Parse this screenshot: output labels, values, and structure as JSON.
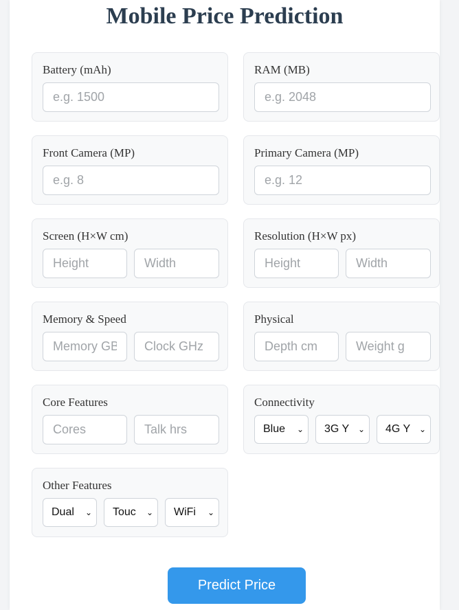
{
  "page": {
    "title": "Mobile Price Prediction"
  },
  "groups": {
    "battery": {
      "label": "Battery (mAh)",
      "placeholder": "e.g. 1500"
    },
    "ram": {
      "label": "RAM (MB)",
      "placeholder": "e.g. 2048"
    },
    "front_camera": {
      "label": "Front Camera (MP)",
      "placeholder": "e.g. 8"
    },
    "primary_camera": {
      "label": "Primary Camera (MP)",
      "placeholder": "e.g. 12"
    },
    "screen": {
      "label": "Screen (H×W cm)",
      "height_placeholder": "Height",
      "width_placeholder": "Width"
    },
    "resolution": {
      "label": "Resolution (H×W px)",
      "height_placeholder": "Height",
      "width_placeholder": "Width"
    },
    "memory_speed": {
      "label": "Memory & Speed",
      "memory_placeholder": "Memory GB",
      "clock_placeholder": "Clock GHz"
    },
    "physical": {
      "label": "Physical",
      "depth_placeholder": "Depth cm",
      "weight_placeholder": "Weight g"
    },
    "core_features": {
      "label": "Core Features",
      "cores_placeholder": "Cores",
      "talk_placeholder": "Talk hrs"
    },
    "connectivity": {
      "label": "Connectivity",
      "bluetooth_value": "Blue",
      "g3_value": "3G Y",
      "g4_value": "4G Y"
    },
    "other_features": {
      "label": "Other Features",
      "dual_value": "Dual",
      "touch_value": "Touc",
      "wifi_value": "WiFi"
    }
  },
  "actions": {
    "predict_label": "Predict Price"
  },
  "colors": {
    "title": "#2c3e50",
    "button_bg": "#3498eb",
    "group_bg": "#f8f9fa"
  }
}
